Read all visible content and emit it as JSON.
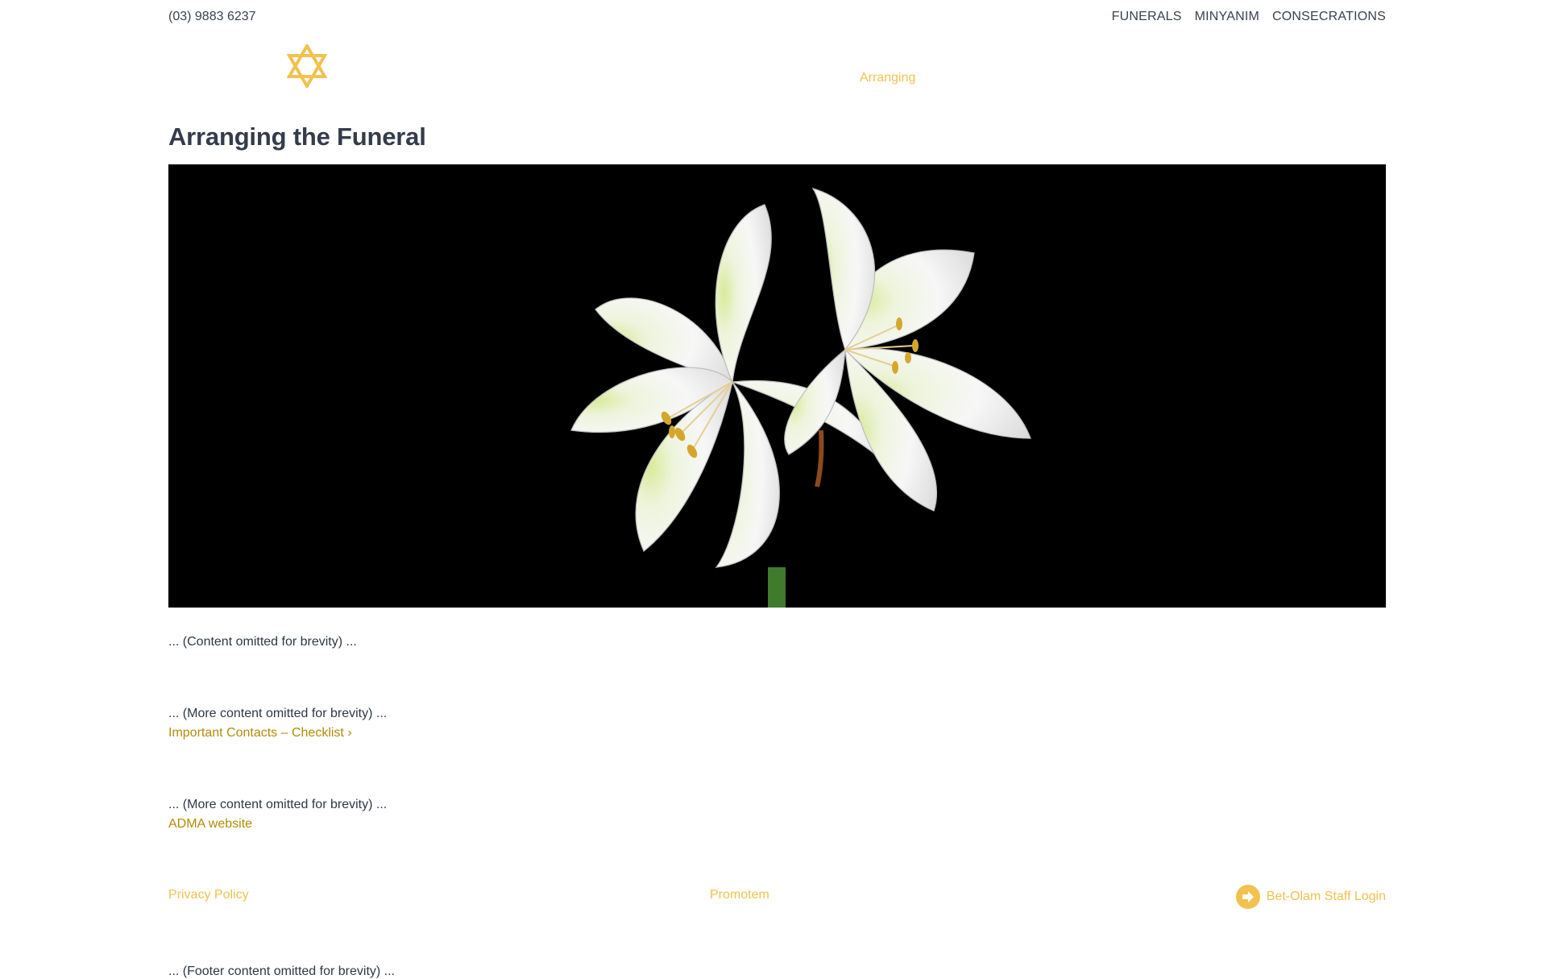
{
  "header": {
    "phone": "(03) 9883 6237",
    "links": [
      "FUNERALS",
      "MINYANIM",
      "CONSECRATIONS"
    ],
    "nav_active": "Arranging"
  },
  "main": {
    "title": "Arranging the Funeral",
    "para1": "... (Content omitted for brevity) ...",
    "para2": "... (More content omitted for brevity) ...",
    "link1": "Important Contacts – Checklist ›",
    "para3": "... (More content omitted for brevity) ...",
    "link2": "ADMA website"
  },
  "footer": {
    "privacy": "Privacy Policy",
    "promotem": "Promotem",
    "staff_login": "Bet-Olam Staff Login",
    "content": "... (Footer content omitted for brevity) ..."
  },
  "icons": {
    "logo": "star-of-david-icon",
    "login": "sign-in-arrow-icon"
  },
  "colors": {
    "accent": "#f2c14e",
    "link": "#b58a06",
    "heading": "#343c4b",
    "text": "#2f3745"
  }
}
